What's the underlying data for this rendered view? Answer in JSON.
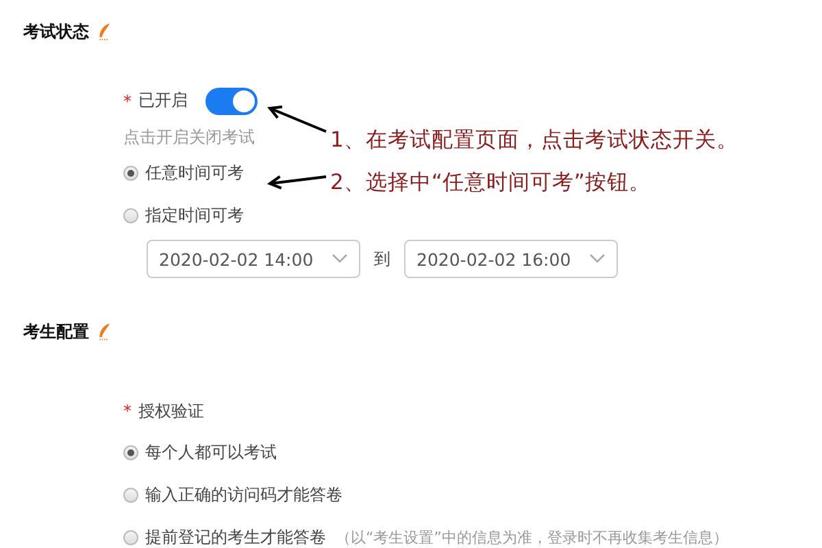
{
  "sections": [
    {
      "title": "考试状态",
      "fields": [
        {
          "kind": "switch",
          "mark": "*",
          "label": "已开启",
          "on": true,
          "hint": "点击开启关闭考试"
        },
        {
          "kind": "radio",
          "label": "任意时间可考",
          "selected": true
        },
        {
          "kind": "radio",
          "label": "指定时间可考",
          "selected": false
        },
        {
          "kind": "daterange",
          "start": "2020-02-02 14:00",
          "separator": "到",
          "end": "2020-02-02 16:00"
        }
      ]
    },
    {
      "title": "考生配置",
      "fields": [
        {
          "kind": "label",
          "mark": "*",
          "label": "授权验证"
        },
        {
          "kind": "radio",
          "label": "每个人都可以考试",
          "selected": true
        },
        {
          "kind": "radio",
          "label": "输入正确的访问码才能答卷",
          "selected": false
        },
        {
          "kind": "radio",
          "label": "提前登记的考生才能答卷",
          "note": "（以“考生设置”中的信息为准，登录时不再收集考生信息）",
          "selected": false
        }
      ]
    }
  ],
  "annotations": [
    {
      "text": "1、在考试配置页面，点击考试状态开关。"
    },
    {
      "text": "2、选择中“任意时间可考”按钮。"
    }
  ]
}
